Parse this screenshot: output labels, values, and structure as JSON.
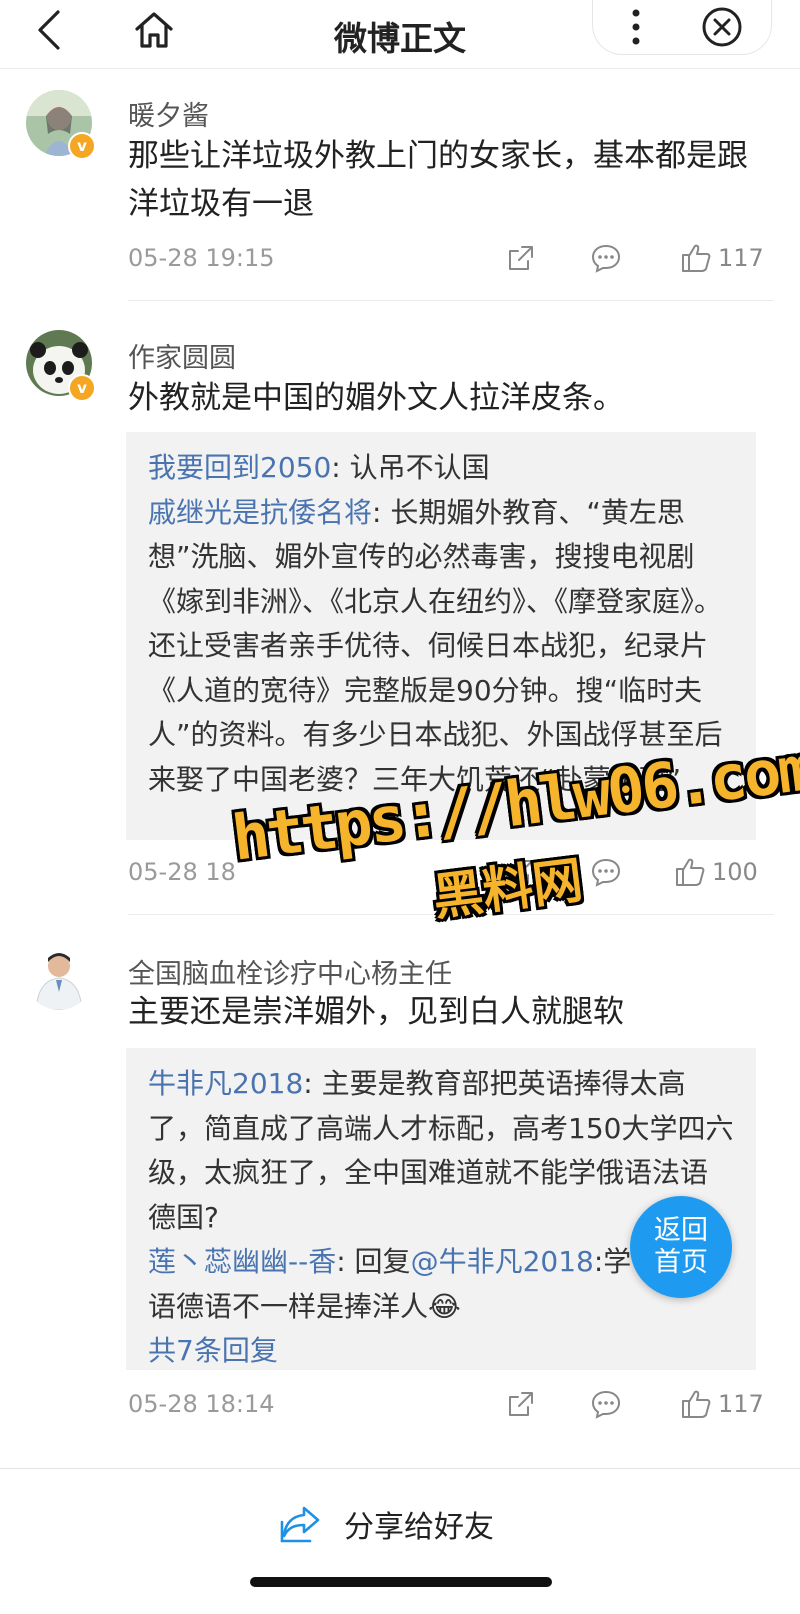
{
  "header": {
    "title": "微博正文",
    "icons": [
      "back-icon",
      "home-icon",
      "more-icon",
      "close-icon"
    ]
  },
  "comments": [
    {
      "user": "暖夕酱",
      "verified": true,
      "text": "那些让洋垃圾外教上门的女家长，基本都是跟洋垃圾有一退",
      "time": "05-28 19:15",
      "likes": "117"
    },
    {
      "user": "作家圆圆",
      "verified": true,
      "text": "外教就是中国的媚外文人拉洋皮条。",
      "replies": [
        {
          "name": "我要回到2050",
          "text": ": 认吊不认国"
        },
        {
          "name": "戚继光是抗倭名将",
          "text": ": 长期媚外教育、“黄左思想”洗脑、媚外宣传的必然毒害，搜搜电视剧《嫁到非洲》、《北京人在纽约》、《摩登家庭》。还让受害者亲手优待、伺候日本战犯，纪录片《人道的宽待》完整版是90分钟。搜“临时夫人”的资料。有多少日本战犯、外国战俘甚至后来娶了中国老婆？三年大饥荒还“赴蒙援建”"
        }
      ],
      "time": "05-28 18",
      "likes": "100"
    },
    {
      "user": "全国脑血栓诊疗中心杨主任",
      "verified": false,
      "text": "主要还是崇洋媚外，见到白人就腿软",
      "replies": [
        {
          "name": "牛非凡2018",
          "text": ": 主要是教育部把英语捧得太高了，简直成了高端人才标配，高考150大学四六级，太疯狂了，全中国难道就不能学俄语法语德国?"
        },
        {
          "name": "莲丶蕊幽幽--香",
          "text": ": 回复",
          "mention": "@牛非凡2018",
          "text2": ":学",
          "text3": "语德语不一样是捧洋人",
          "emoji": "😂"
        }
      ],
      "more_replies": "共7条回复",
      "time": "05-28 18:14",
      "likes": "117"
    }
  ],
  "watermark": {
    "line1": "https://hlw06.com",
    "line2": "黑料网"
  },
  "fab": {
    "line1": "返回",
    "line2": "首页"
  },
  "bottom": {
    "share_label": "分享给好友"
  },
  "colors": {
    "link": "#4a74b0",
    "fab": "#1e9bf0",
    "badge": "#f5a623",
    "watermark": "#f5b42c"
  }
}
